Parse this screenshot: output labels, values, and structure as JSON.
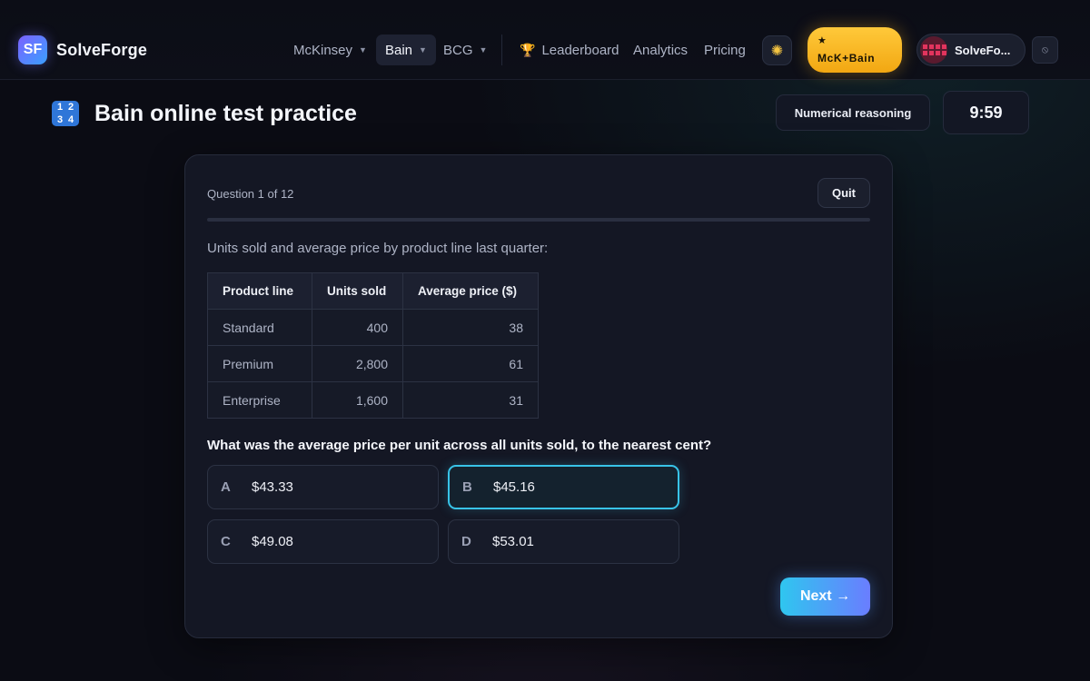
{
  "brand": {
    "mark": "SF",
    "name": "SolveForge"
  },
  "nav": {
    "items": [
      {
        "label": "McKinsey",
        "dropdown": true
      },
      {
        "label": "Bain",
        "dropdown": true,
        "active": true
      },
      {
        "label": "BCG",
        "dropdown": true
      }
    ],
    "links": [
      "Leaderboard",
      "Analytics",
      "Pricing"
    ],
    "leaderboard_icon": "trophy-icon"
  },
  "actions": {
    "theme_icon": "sun-icon",
    "pro_star": "★",
    "pro_label": "McK+Bain",
    "user_name": "SolveFo...",
    "mini_icon": "circle-slash-icon"
  },
  "header": {
    "icon_digits": [
      "1",
      "2",
      "3",
      "4"
    ],
    "title": "Bain online test practice",
    "mode": "Numerical reasoning",
    "timer": "9:59"
  },
  "quiz": {
    "question_counter": "Question 1 of 12",
    "quit_label": "Quit",
    "progress_fraction": 0,
    "prompt": "Units sold and average price by product line last quarter:",
    "table": {
      "columns": [
        "Product line",
        "Units sold",
        "Average price ($)"
      ],
      "rows": [
        [
          "Standard",
          "400",
          "38"
        ],
        [
          "Premium",
          "2,800",
          "61"
        ],
        [
          "Enterprise",
          "1,600",
          "31"
        ]
      ]
    },
    "question": "What was the average price per unit across all units sold, to the nearest cent?",
    "options": [
      {
        "letter": "A",
        "value": "$43.33"
      },
      {
        "letter": "B",
        "value": "$45.16",
        "selected": true
      },
      {
        "letter": "C",
        "value": "$49.08"
      },
      {
        "letter": "D",
        "value": "$53.01"
      }
    ],
    "next_label": "Next →"
  },
  "colors": {
    "accent_cyan": "#38c3e8",
    "accent_violet": "#6a7dff",
    "pro_gold": "#ffc93a",
    "background": "#0b0c14"
  }
}
